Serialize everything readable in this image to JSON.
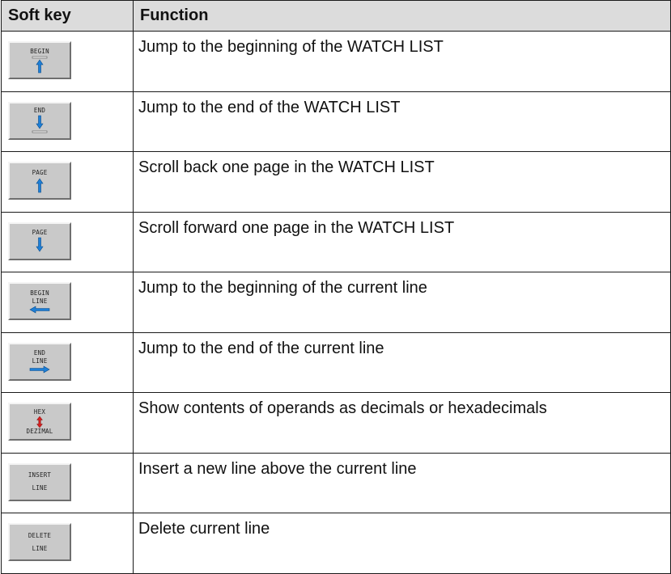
{
  "table": {
    "headers": {
      "softkey": "Soft key",
      "function": "Function"
    },
    "rows": [
      {
        "key_label_1": "BEGIN",
        "key_label_2": "",
        "icon": "begin-arrow-up-icon",
        "function": "Jump to the beginning of the WATCH LIST"
      },
      {
        "key_label_1": "END",
        "key_label_2": "",
        "icon": "end-arrow-down-icon",
        "function": "Jump to the end of the WATCH LIST"
      },
      {
        "key_label_1": "PAGE",
        "key_label_2": "",
        "icon": "arrow-up-icon",
        "function": "Scroll back one page in the WATCH LIST"
      },
      {
        "key_label_1": "PAGE",
        "key_label_2": "",
        "icon": "arrow-down-icon",
        "function": "Scroll forward one page in the WATCH LIST"
      },
      {
        "key_label_1": "BEGIN",
        "key_label_2": "LINE",
        "icon": "arrow-left-icon",
        "function": "Jump to the beginning of the current line"
      },
      {
        "key_label_1": "END",
        "key_label_2": "LINE",
        "icon": "arrow-right-icon",
        "function": "Jump to the end of the current line"
      },
      {
        "key_label_1": "HEX",
        "key_label_2": "DEZIMAL",
        "icon": "double-arrow-vertical-icon",
        "function": "Show contents of operands as decimals or hexadecimals"
      },
      {
        "key_label_1": "INSERT",
        "key_label_2": "LINE",
        "icon": "",
        "function": "Insert a new line above the current line"
      },
      {
        "key_label_1": "DELETE",
        "key_label_2": "LINE",
        "icon": "",
        "function": "Delete current line"
      }
    ]
  },
  "colors": {
    "header_bg": "#dcdcdc",
    "key_bg": "#c9c9c9",
    "arrow_blue": "#1e7fd6",
    "arrow_red": "#d62020"
  }
}
